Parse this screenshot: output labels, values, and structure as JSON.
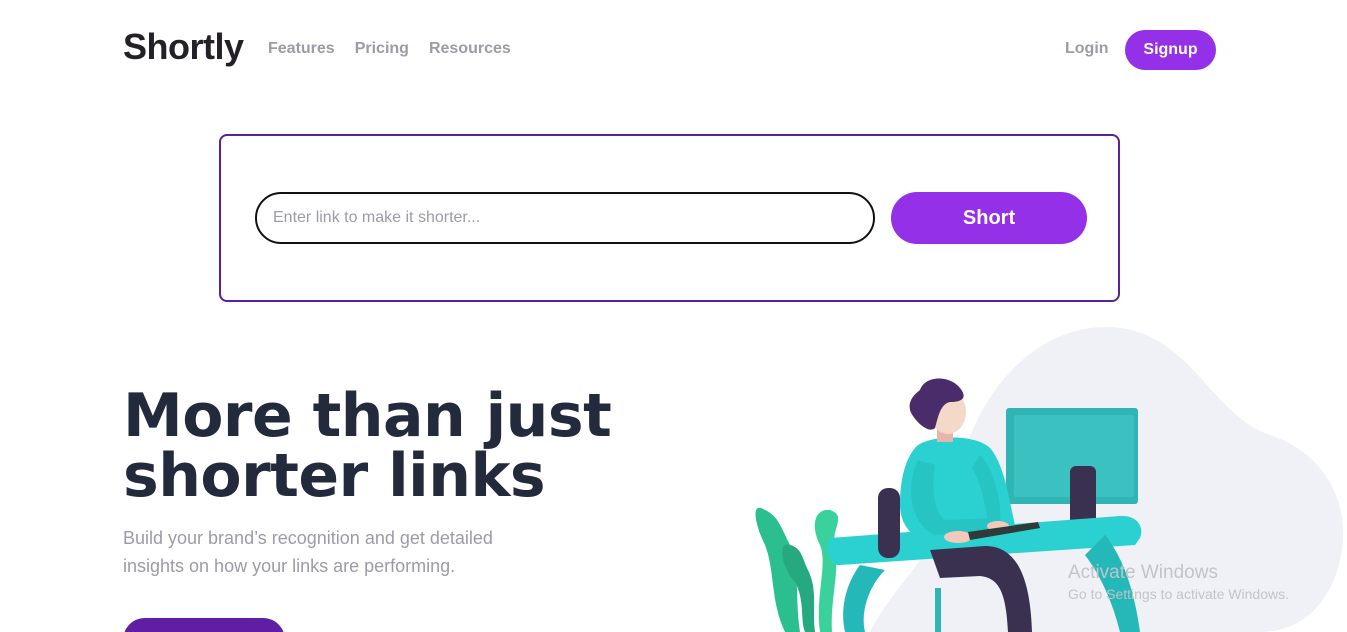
{
  "header": {
    "logo": "Shortly",
    "nav": [
      {
        "label": "Features"
      },
      {
        "label": "Pricing"
      },
      {
        "label": "Resources"
      }
    ],
    "login_label": "Login",
    "signup_label": "Signup"
  },
  "shortener": {
    "placeholder": "Enter link to make it shorter...",
    "value": "",
    "button_label": "Short"
  },
  "hero": {
    "title_line1": "More than just",
    "title_line2": "shorter links",
    "subtitle_line1": "Build your brand’s recognition and get detailed",
    "subtitle_line2": "insights on how your links are performing.",
    "cta_label": ""
  },
  "illustration": {
    "icon": "person-working-illustration"
  },
  "watermark": {
    "title": "Activate Windows",
    "subtitle": "Go to Settings to activate Windows."
  },
  "colors": {
    "primary": "#9330e8",
    "dark_violet": "#5a2293",
    "text_dark": "#232127",
    "text_gray": "#9e9aa7",
    "teal": "#2bd0d0"
  }
}
